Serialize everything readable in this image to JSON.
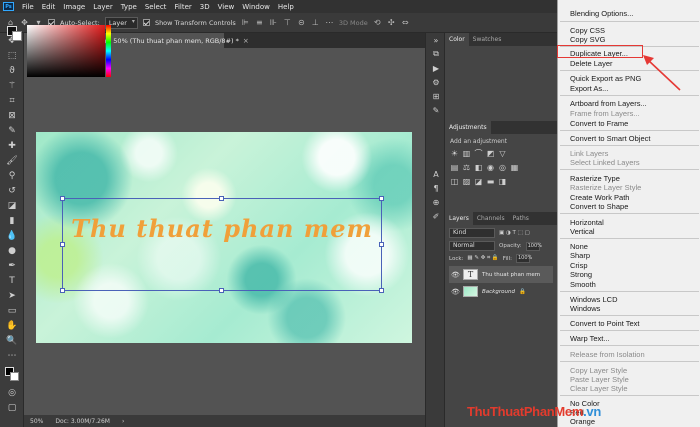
{
  "menubar": {
    "items": [
      "File",
      "Edit",
      "Image",
      "Layer",
      "Type",
      "Select",
      "Filter",
      "3D",
      "View",
      "Window",
      "Help"
    ]
  },
  "options": {
    "auto_select_label": "Auto-Select:",
    "auto_select_value": "Layer",
    "transform_label": "Show Transform Controls",
    "mode_3d": "3D Mode"
  },
  "document": {
    "tab_title": "Thuthuatphanmem.jpg @ 50% (Thu thuat phan mem, RGB/8#) *",
    "canvas_text": "Thu thuat phan mem"
  },
  "status": {
    "zoom": "50%",
    "doc": "Doc: 3.00M/7.26M"
  },
  "panels": {
    "color_tab": "Color",
    "swatches_tab": "Swatches",
    "adjustments_tab": "Adjustments",
    "add_adjustment": "Add an adjustment",
    "layers_tab": "Layers",
    "channels_tab": "Channels",
    "paths_tab": "Paths",
    "kind_value": "Kind",
    "blend_mode": "Normal",
    "opacity_label": "Opacity:",
    "opacity_value": "100%",
    "lock_label": "Lock:",
    "fill_label": "Fill:",
    "fill_value": "100%",
    "layers": [
      {
        "name": "Thu thuat phan mem"
      },
      {
        "name": "Background"
      }
    ]
  },
  "context_menu": {
    "items": [
      {
        "label": "Blending Options...",
        "enabled": true
      },
      {
        "label": "Copy CSS",
        "enabled": true
      },
      {
        "label": "Copy SVG",
        "enabled": true
      },
      {
        "label": "Duplicate Layer...",
        "enabled": true,
        "highlighted": true
      },
      {
        "label": "Delete Layer",
        "enabled": true
      },
      {
        "label": "Quick Export as PNG",
        "enabled": true
      },
      {
        "label": "Export As...",
        "enabled": true
      },
      {
        "label": "Artboard from Layers...",
        "enabled": true
      },
      {
        "label": "Frame from Layers...",
        "enabled": false
      },
      {
        "label": "Convert to Frame",
        "enabled": true
      },
      {
        "label": "Convert to Smart Object",
        "enabled": true
      },
      {
        "label": "Link Layers",
        "enabled": false
      },
      {
        "label": "Select Linked Layers",
        "enabled": false
      },
      {
        "label": "Rasterize Type",
        "enabled": true
      },
      {
        "label": "Rasterize Layer Style",
        "enabled": false
      },
      {
        "label": "Create Work Path",
        "enabled": true
      },
      {
        "label": "Convert to Shape",
        "enabled": true
      },
      {
        "label": "Horizontal",
        "enabled": true
      },
      {
        "label": "Vertical",
        "enabled": true
      },
      {
        "label": "None",
        "enabled": true
      },
      {
        "label": "Sharp",
        "enabled": true
      },
      {
        "label": "Crisp",
        "enabled": true
      },
      {
        "label": "Strong",
        "enabled": true
      },
      {
        "label": "Smooth",
        "enabled": true
      },
      {
        "label": "Windows LCD",
        "enabled": true
      },
      {
        "label": "Windows",
        "enabled": true
      },
      {
        "label": "Convert to Point Text",
        "enabled": true
      },
      {
        "label": "Warp Text...",
        "enabled": true
      },
      {
        "label": "Release from Isolation",
        "enabled": false
      },
      {
        "label": "Copy Layer Style",
        "enabled": false
      },
      {
        "label": "Paste Layer Style",
        "enabled": false
      },
      {
        "label": "Clear Layer Style",
        "enabled": false
      },
      {
        "label": "No Color",
        "enabled": true
      },
      {
        "label": "Red",
        "enabled": true
      },
      {
        "label": "Orange",
        "enabled": true
      }
    ]
  },
  "watermark": {
    "part1": "ThuThuat",
    "part2": "PhanMem",
    "part3": ".vn"
  },
  "colors": {
    "highlight_box": "#e53935",
    "canvas_text": "#f0a03a",
    "selection": "#4a62b8"
  }
}
